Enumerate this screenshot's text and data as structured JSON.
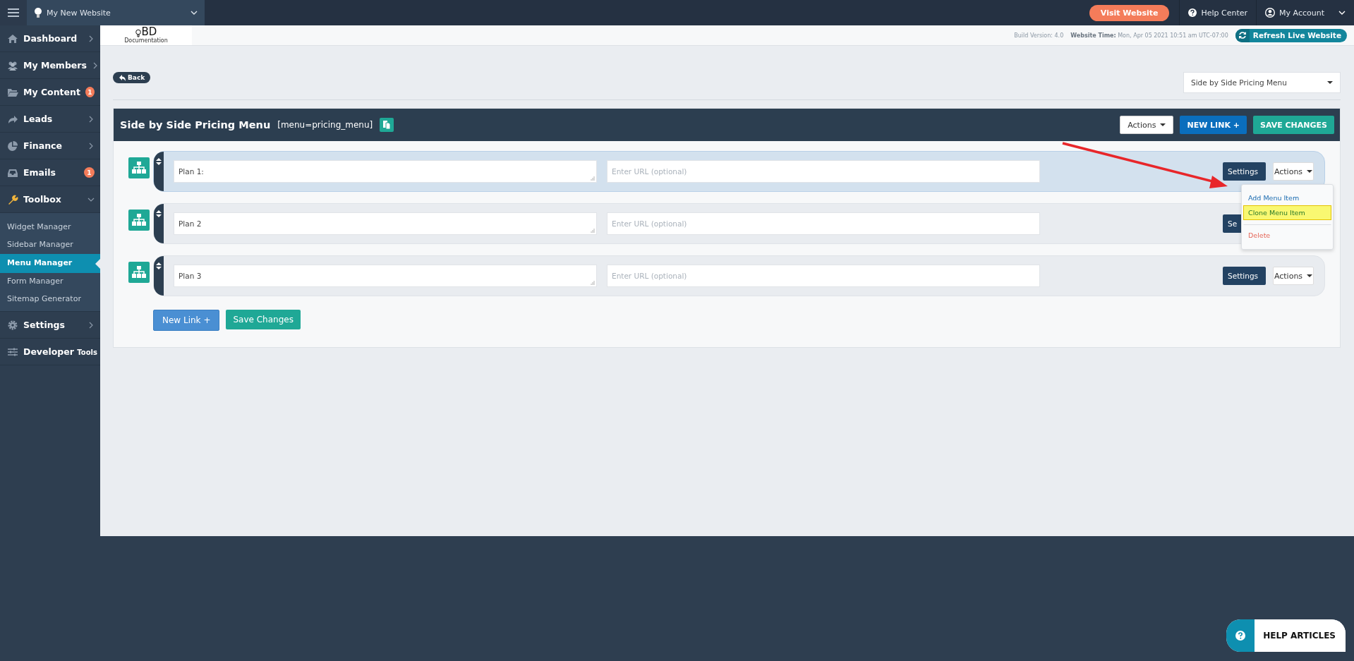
{
  "topbar": {
    "site": "My New Website",
    "visit_button": "Visit Website",
    "help": "Help Center",
    "account": "My Account"
  },
  "sidebar": {
    "items": [
      {
        "label": "Dashboard",
        "chevron": true
      },
      {
        "label": "My Members",
        "chevron": true
      },
      {
        "label": "My Content",
        "badge": "1"
      },
      {
        "label": "Leads",
        "chevron": true
      },
      {
        "label": "Finance",
        "chevron": true
      },
      {
        "label": "Emails",
        "badge": "1"
      },
      {
        "label": "Toolbox",
        "chevron": true,
        "expanded": true,
        "children": [
          {
            "label": "Widget Manager",
            "selected": false
          },
          {
            "label": "Sidebar Manager",
            "selected": false
          },
          {
            "label": "Menu Manager",
            "selected": true
          },
          {
            "label": "Form Manager",
            "selected": false
          },
          {
            "label": "Sitemap Generator",
            "selected": false
          }
        ]
      },
      {
        "label": "Settings",
        "chevron": true
      },
      {
        "label": "Developer",
        "suffix": "Tools"
      }
    ]
  },
  "header": {
    "logo": "BD",
    "logo_caption": "Documentation",
    "build": "Build Version: 4.0",
    "time": "**Website Time:** Mon, Apr 05 2021 10:51 am UTC-07:00",
    "refresh_button": "Refresh Live Website"
  },
  "back_button": "Back",
  "menu_select": "Side by Side Pricing Menu",
  "panel": {
    "title": "Side by Side Pricing Menu",
    "shortcode": "[menu=pricing_menu]",
    "actions_button": "Actions",
    "new_link_button": "NEW LINK +",
    "save_button": "SAVE CHANGES",
    "rows": [
      {
        "label": "Plan 1:",
        "url_placeholder": "Enter URL (optional)",
        "settings": "Settings",
        "actions": "Actions",
        "selected": true,
        "menu": [
          {
            "label": "Add Menu Item",
            "kind": "normal",
            "highlighted": false
          },
          {
            "label": "Clone Menu Item",
            "kind": "normal",
            "highlighted": true
          },
          {
            "label": "Delete",
            "kind": "danger",
            "highlighted": false
          }
        ]
      },
      {
        "label": "Plan 2",
        "url_placeholder": "Enter URL (optional)",
        "settings": "Se",
        "selected": false
      },
      {
        "label": "Plan 3",
        "url_placeholder": "Enter URL (optional)",
        "settings": "Settings",
        "actions": "Actions",
        "selected": false
      }
    ],
    "footer_new_link": "New Link +",
    "footer_save": "Save Changes"
  },
  "help_articles": "HELP ARTICLES"
}
